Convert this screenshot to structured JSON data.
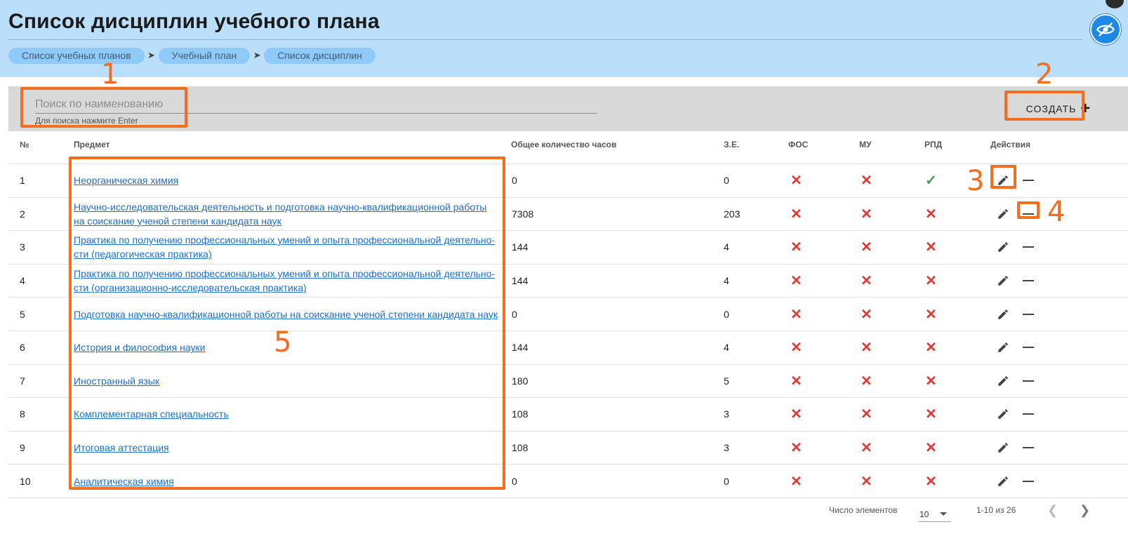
{
  "header": {
    "title": "Список дисциплин учебного плана",
    "breadcrumbs": [
      "Список учебных планов",
      "Учебный план",
      "Список дисциплин"
    ]
  },
  "search": {
    "placeholder": "Поиск по наименованию",
    "hint": "Для поиска нажмите Enter"
  },
  "toolbar": {
    "create_label": "СОЗДАТЬ"
  },
  "annotations": [
    "1",
    "2",
    "3",
    "4",
    "5"
  ],
  "table": {
    "columns": [
      "№",
      "Предмет",
      "Общее количество часов",
      "З.Е.",
      "ФОС",
      "МУ",
      "РПД",
      "Действия"
    ],
    "rows": [
      {
        "num": "1",
        "subject_1": "Неорганическая химия",
        "subject_2": "",
        "hours": "0",
        "ze": "0",
        "fos": "no",
        "mu": "no",
        "rpd": "yes"
      },
      {
        "num": "2",
        "subject_1": "Научно-исследовательская деятельность и подготовка научно-квалификационной работы",
        "subject_2": "на соискание ученой степени кандидата наук",
        "hours": "7308",
        "ze": "203",
        "fos": "no",
        "mu": "no",
        "rpd": "no"
      },
      {
        "num": "3",
        "subject_1": "Практика по получению профессиональных умений и опыта профессиональной деятельно-",
        "subject_2": "сти (педагогическая практика)",
        "hours": "144",
        "ze": "4",
        "fos": "no",
        "mu": "no",
        "rpd": "no"
      },
      {
        "num": "4",
        "subject_1": "Практика по получению профессиональных умений и опыта профессиональной деятельно-",
        "subject_2": "сти (организационно-исследовательская практика)",
        "hours": "144",
        "ze": "4",
        "fos": "no",
        "mu": "no",
        "rpd": "no"
      },
      {
        "num": "5",
        "subject_1": "Подготовка научно-квалификационной работы на соискание ученой степени кандидата наук",
        "subject_2": "",
        "hours": "0",
        "ze": "0",
        "fos": "no",
        "mu": "no",
        "rpd": "no"
      },
      {
        "num": "6",
        "subject_1": "История и философия науки",
        "subject_2": "",
        "hours": "144",
        "ze": "4",
        "fos": "no",
        "mu": "no",
        "rpd": "no"
      },
      {
        "num": "7",
        "subject_1": "Иностранный язык",
        "subject_2": "",
        "hours": "180",
        "ze": "5",
        "fos": "no",
        "mu": "no",
        "rpd": "no"
      },
      {
        "num": "8",
        "subject_1": "Комплементарная специальность",
        "subject_2": "",
        "hours": "108",
        "ze": "3",
        "fos": "no",
        "mu": "no",
        "rpd": "no"
      },
      {
        "num": "9",
        "subject_1": "Итоговая аттестация",
        "subject_2": "",
        "hours": "108",
        "ze": "3",
        "fos": "no",
        "mu": "no",
        "rpd": "no"
      },
      {
        "num": "10",
        "subject_1": "Аналитическая химия",
        "subject_2": "",
        "hours": "0",
        "ze": "0",
        "fos": "no",
        "mu": "no",
        "rpd": "no"
      }
    ]
  },
  "pagination": {
    "items_label": "Число элементов",
    "page_size": "10",
    "range": "1-10 из 26"
  },
  "icons": {
    "yes": "check-icon",
    "no": "cross-icon",
    "edit": "pencil-icon",
    "remove": "minus-icon",
    "accessibility": "eye-slash-icon"
  },
  "colors": {
    "header_bg": "#bbdefb",
    "crumb_bg": "#90caf9",
    "annotation": "#f26f21",
    "cross": "#e53935",
    "check": "#43a047",
    "link": "#1e6fd0"
  }
}
